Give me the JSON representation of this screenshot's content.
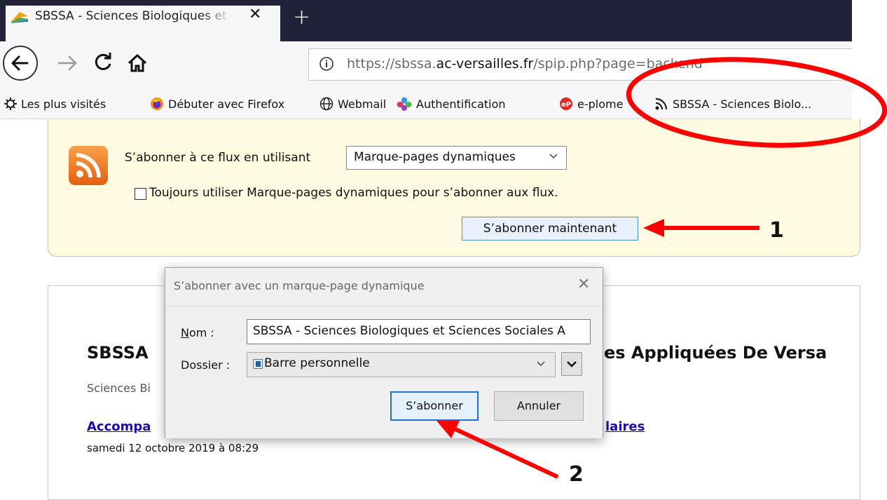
{
  "browser": {
    "tab_title": "SBSSA - Sciences Biologiques et Sciences Sociales Appliquées",
    "tab_close": "✕",
    "new_tab": "+",
    "url_prefix": "https://sbssa.",
    "url_domain": "ac-versailles.fr",
    "url_path": "/spip.php?page=backend",
    "bookmarks": [
      {
        "label": "Les plus visités",
        "icon": "gear-icon"
      },
      {
        "label": "Débuter avec Firefox",
        "icon": "firefox-icon"
      },
      {
        "label": "Webmail",
        "icon": "globe-icon"
      },
      {
        "label": "Authentification",
        "icon": "pinwheel-icon"
      },
      {
        "label": "e-plome",
        "icon": "eplome-icon"
      },
      {
        "label": "SBSSA - Sciences Biolo...",
        "icon": "rss-icon"
      }
    ]
  },
  "feed": {
    "subscribe_label": "S’abonner à ce flux en utilisant",
    "reader_selected": "Marque-pages dynamiques",
    "always_label": "Toujours utiliser Marque-pages dynamiques pour s’abonner aux flux.",
    "always_checked": false,
    "subscribe_now": "S’abonner maintenant"
  },
  "page": {
    "heading_left": "SBSSA",
    "heading_right": "es Appliquées De Versa",
    "subtitle": "Sciences Bi",
    "article_link_left": "Accompa",
    "article_link_right": "laires",
    "article_date": "samedi 12 octobre 2019 à 08:29"
  },
  "dialog": {
    "title": "S’abonner avec un marque-page dynamique",
    "nom_label_u": "N",
    "nom_label_rest": "om :",
    "nom_value": "SBSSA - Sciences Biologiques et Sciences Sociales A",
    "dossier_label": "Dossier :",
    "dossier_value": "Barre personnelle",
    "subscribe_button": "S’abonner",
    "cancel_button": "Annuler"
  },
  "annotations": {
    "step1": "1",
    "step2": "2",
    "color": "#ff0000"
  }
}
